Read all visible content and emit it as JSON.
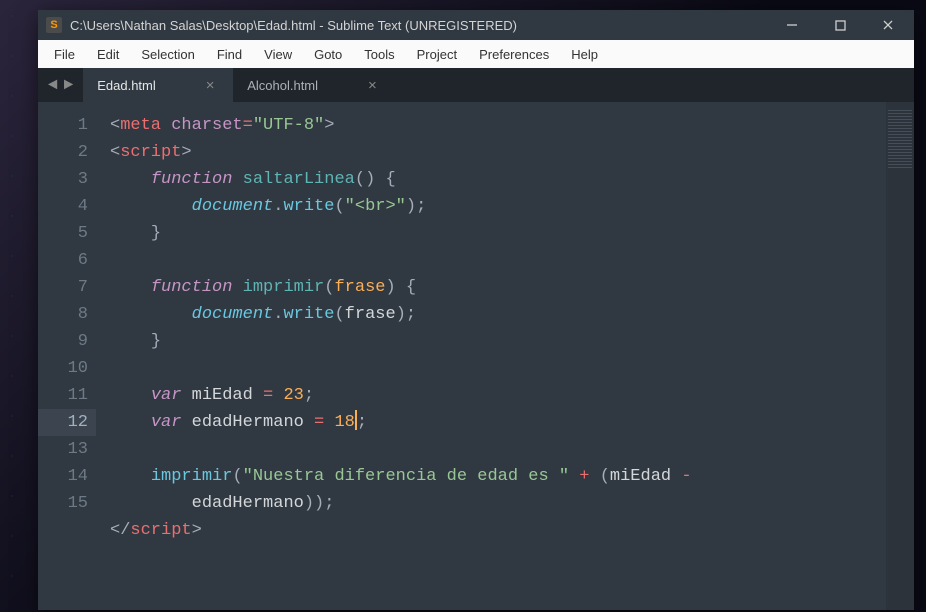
{
  "titlebar": {
    "path": "C:\\Users\\Nathan Salas\\Desktop\\Edad.html - Sublime Text (UNREGISTERED)"
  },
  "menu": [
    "File",
    "Edit",
    "Selection",
    "Find",
    "View",
    "Goto",
    "Tools",
    "Project",
    "Preferences",
    "Help"
  ],
  "tabs": [
    {
      "label": "Edad.html",
      "active": true
    },
    {
      "label": "Alcohol.html",
      "active": false
    }
  ],
  "lines": [
    "1",
    "2",
    "3",
    "4",
    "5",
    "6",
    "7",
    "8",
    "9",
    "10",
    "11",
    "12",
    "13",
    "14",
    "",
    "15"
  ],
  "active_line_index": 11,
  "code": {
    "l1": {
      "tag_open": "<",
      "tag": "meta",
      "attr": "charset",
      "eq": "=",
      "val": "\"UTF-8\"",
      "tag_close": ">"
    },
    "l2": {
      "tag_open": "<",
      "tag": "script",
      "tag_close": ">"
    },
    "l3": {
      "kw": "function",
      "name": "saltarLinea",
      "p1": "(",
      "p2": ")",
      "brace": "{"
    },
    "l4": {
      "obj": "document",
      "dot": ".",
      "fn": "write",
      "p1": "(",
      "str": "\"<br>\"",
      "p2": ")",
      "semi": ";"
    },
    "l5": {
      "brace": "}"
    },
    "l7": {
      "kw": "function",
      "name": "imprimir",
      "p1": "(",
      "param": "frase",
      "p2": ")",
      "brace": "{"
    },
    "l8": {
      "obj": "document",
      "dot": ".",
      "fn": "write",
      "p1": "(",
      "param": "frase",
      "p2": ")",
      "semi": ";"
    },
    "l9": {
      "brace": "}"
    },
    "l11": {
      "kw": "var",
      "id": "miEdad",
      "eq": "=",
      "num": "23",
      "semi": ";"
    },
    "l12": {
      "kw": "var",
      "id": "edadHermano",
      "eq": "=",
      "num": "18",
      "semi": ";"
    },
    "l14": {
      "fn": "imprimir",
      "p1": "(",
      "str": "\"Nuestra diferencia de edad es \"",
      "plus": "+",
      "p2": "(",
      "id1": "miEdad",
      "minus": "-",
      "id2": "edadHermano",
      "p3": ")",
      "p4": ")",
      "semi": ";"
    },
    "l15": {
      "tag_open": "</",
      "tag": "script",
      "tag_close": ">"
    }
  }
}
